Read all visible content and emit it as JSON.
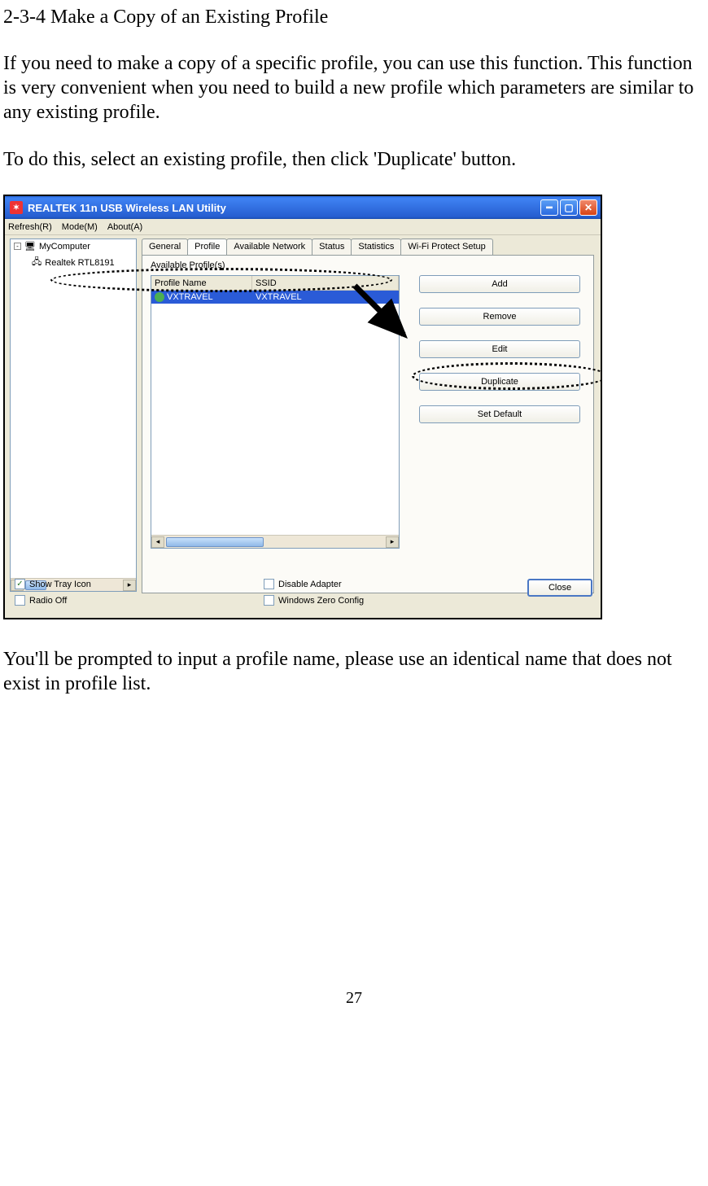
{
  "doc": {
    "heading": "2-3-4 Make a Copy of an Existing Profile",
    "para1": "If you need to make a copy of a specific profile, you can use this function. This function is very convenient when you need to build a new profile which parameters are similar to any existing profile.",
    "para2": "To do this, select an existing profile, then click 'Duplicate' button.",
    "para3": "You'll be prompted to input a profile name, please use an identical name that does not exist in profile list.",
    "page_number": "27"
  },
  "window": {
    "title": "REALTEK 11n USB Wireless LAN Utility",
    "menu": {
      "refresh": "Refresh(R)",
      "mode": "Mode(M)",
      "about": "About(A)"
    },
    "tree": {
      "root": "MyComputer",
      "child": "Realtek RTL8191"
    },
    "tabs": {
      "general": "General",
      "profile": "Profile",
      "available": "Available Network",
      "status": "Status",
      "statistics": "Statistics",
      "wps": "Wi-Fi Protect Setup"
    },
    "profile": {
      "section_label": "Available Profile(s)",
      "col_profile": "Profile Name",
      "col_ssid": "SSID",
      "row_name": "VXTRAVEL",
      "row_ssid": "VXTRAVEL"
    },
    "buttons": {
      "add": "Add",
      "remove": "Remove",
      "edit": "Edit",
      "duplicate": "Duplicate",
      "setdefault": "Set Default",
      "close": "Close"
    },
    "checks": {
      "show_tray": "Show Tray Icon",
      "radio_off": "Radio Off",
      "disable_adapter": "Disable Adapter",
      "wzc": "Windows Zero Config"
    }
  }
}
